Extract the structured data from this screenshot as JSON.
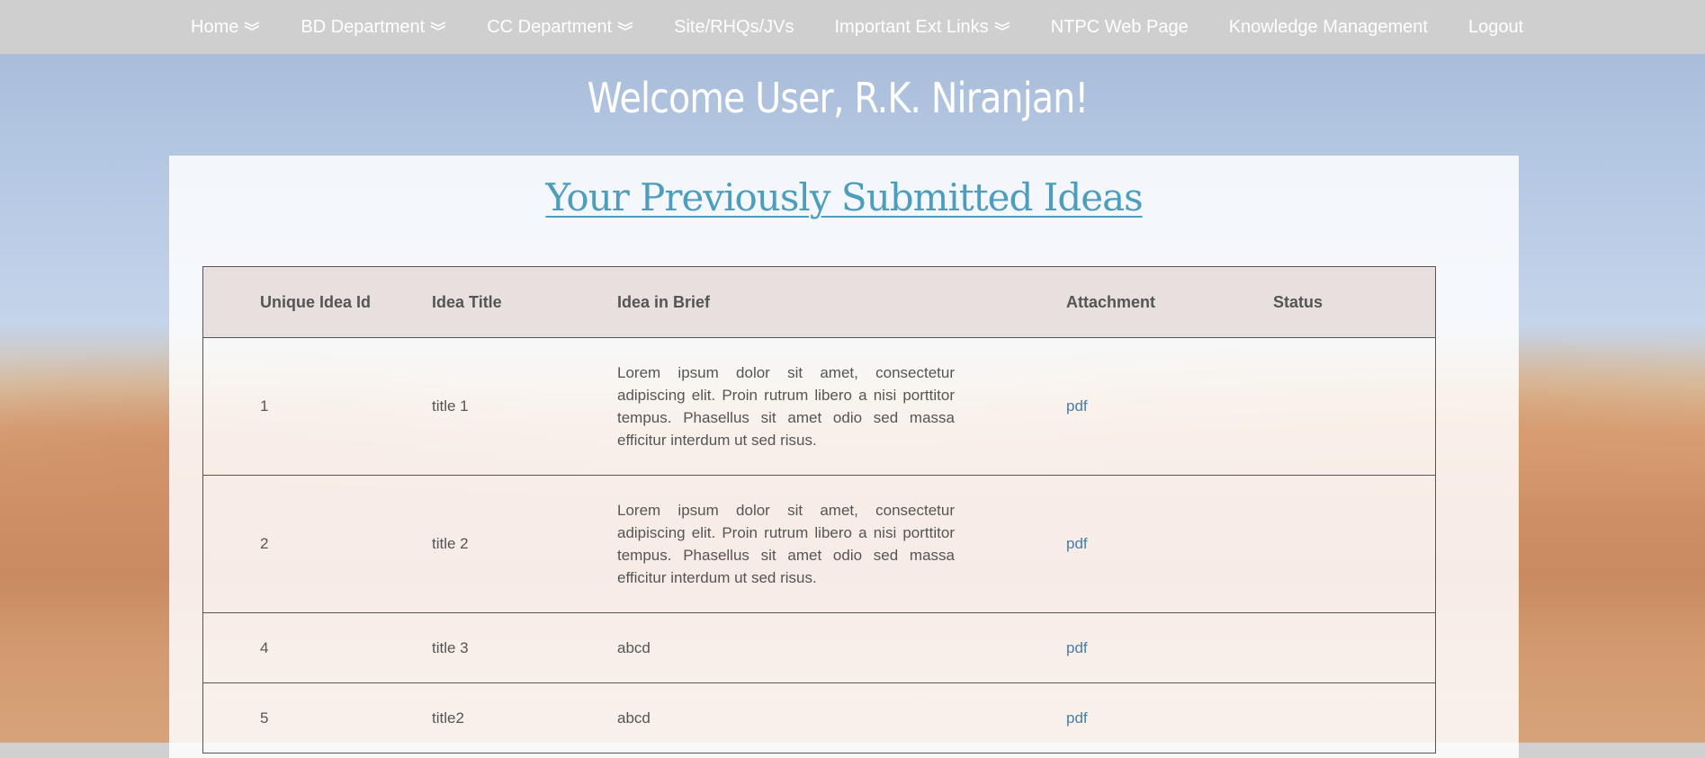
{
  "nav": {
    "items": [
      {
        "label": "Home",
        "has_dropdown": true
      },
      {
        "label": "BD Department",
        "has_dropdown": true
      },
      {
        "label": "CC Department",
        "has_dropdown": true
      },
      {
        "label": "Site/RHQs/JVs",
        "has_dropdown": false
      },
      {
        "label": "Important Ext Links",
        "has_dropdown": true
      },
      {
        "label": "NTPC Web Page",
        "has_dropdown": false
      },
      {
        "label": "Knowledge Management",
        "has_dropdown": false
      },
      {
        "label": "Logout",
        "has_dropdown": false
      }
    ]
  },
  "welcome": "Welcome User, R.K. Niranjan!",
  "panel": {
    "title": "Your Previously Submitted Ideas"
  },
  "table": {
    "headers": [
      "Unique Idea Id",
      "Idea Title",
      "Idea in Brief",
      "Attachment",
      "Status"
    ],
    "rows": [
      {
        "id": "1",
        "title": "title 1",
        "brief": "Lorem ipsum dolor sit amet, consectetur adipiscing elit. Proin rutrum libero a nisi porttitor tempus. Phasellus sit amet odio sed massa efficitur interdum ut sed risus.",
        "attachment": "pdf",
        "status": ""
      },
      {
        "id": "2",
        "title": "title 2",
        "brief": "Lorem ipsum dolor sit amet, consectetur adipiscing elit. Proin rutrum libero a nisi porttitor tempus. Phasellus sit amet odio sed massa efficitur interdum ut sed risus.",
        "attachment": "pdf",
        "status": ""
      },
      {
        "id": "4",
        "title": "title 3",
        "brief": "abcd",
        "attachment": "pdf",
        "status": ""
      },
      {
        "id": "5",
        "title": "title2",
        "brief": "abcd",
        "attachment": "pdf",
        "status": ""
      }
    ]
  },
  "colors": {
    "nav_bg": "#cfcfcf",
    "title_link": "#4d9dbd",
    "pdf_link": "#4a7ba6",
    "text": "#555555"
  },
  "icons": {
    "dropdown": "double-chevron-down-icon"
  }
}
